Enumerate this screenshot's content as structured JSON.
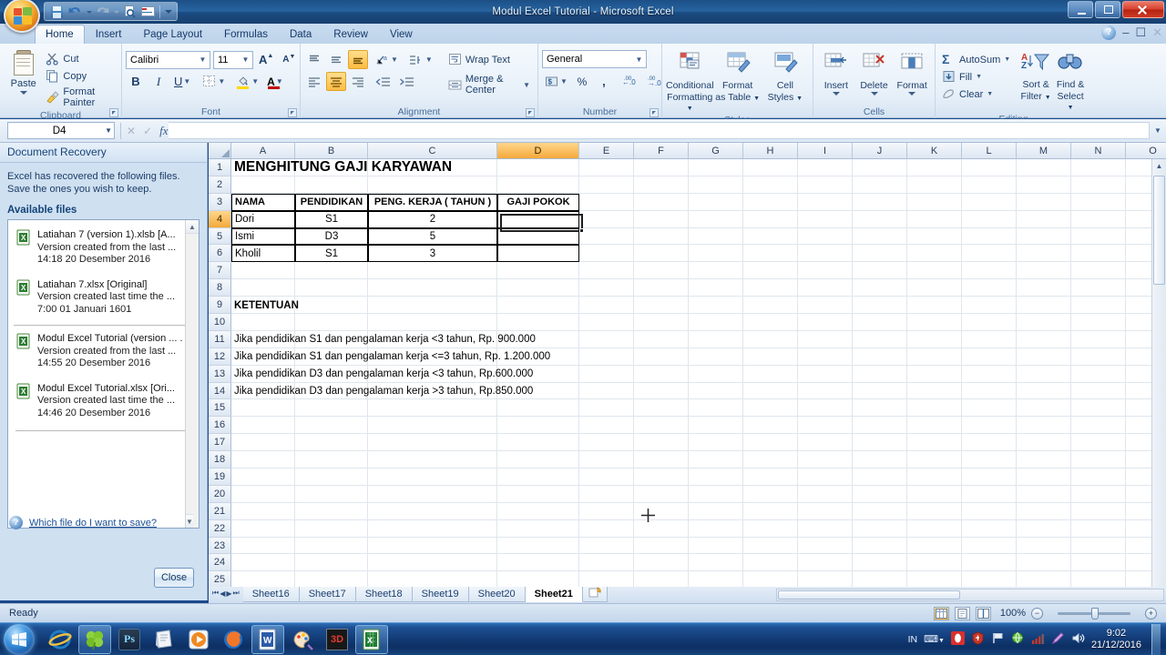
{
  "window": {
    "title": "Modul Excel Tutorial - Microsoft Excel",
    "minimize_label": "Minimize",
    "restore_label": "Restore",
    "close_label": "Close"
  },
  "quick_access": {
    "items": [
      {
        "name": "save-icon",
        "label": "Save"
      },
      {
        "name": "undo-icon",
        "label": "Undo"
      },
      {
        "name": "undo-dropdown-icon",
        "label": "Undo options"
      },
      {
        "name": "redo-icon",
        "label": "Redo"
      },
      {
        "name": "redo-dropdown-icon",
        "label": "Redo options"
      },
      {
        "name": "print-preview-icon",
        "label": "Print Preview"
      },
      {
        "name": "spelling-icon",
        "label": "Spelling"
      },
      {
        "name": "customize-qat-icon",
        "label": "Customize Quick Access Toolbar"
      }
    ]
  },
  "ribbon": {
    "tabs": [
      {
        "label": "Home",
        "active": true
      },
      {
        "label": "Insert",
        "active": false
      },
      {
        "label": "Page Layout",
        "active": false
      },
      {
        "label": "Formulas",
        "active": false
      },
      {
        "label": "Data",
        "active": false
      },
      {
        "label": "Review",
        "active": false
      },
      {
        "label": "View",
        "active": false
      }
    ],
    "help_label": "?",
    "clipboard": {
      "group_label": "Clipboard",
      "paste_label": "Paste",
      "cut_label": "Cut",
      "copy_label": "Copy",
      "format_painter_label": "Format Painter"
    },
    "font": {
      "group_label": "Font",
      "font_name": "Calibri",
      "font_size": "11",
      "grow_font_label": "A",
      "shrink_font_label": "A",
      "bold_label": "B",
      "italic_label": "I",
      "underline_label": "U",
      "borders_label": "Borders",
      "fill_color_label": "Fill Color",
      "font_color_label": "A"
    },
    "alignment": {
      "group_label": "Alignment",
      "wrap_text_label": "Wrap Text",
      "merge_center_label": "Merge & Center",
      "top_align_label": "Top Align",
      "middle_align_label": "Middle Align",
      "bottom_align_label": "Bottom Align",
      "orientation_label": "Orientation",
      "indent_label": "Indent",
      "align_left_label": "Align Text Left",
      "align_center_label": "Center",
      "align_right_label": "Align Text Right",
      "decrease_indent_label": "Decrease Indent",
      "increase_indent_label": "Increase Indent"
    },
    "number": {
      "group_label": "Number",
      "format_value": "General",
      "accounting_label": "Accounting Number Format",
      "percent_label": "%",
      "comma_label": "Comma Style",
      "increase_decimal_label": "Increase Decimal",
      "decrease_decimal_label": "Decrease Decimal"
    },
    "styles": {
      "group_label": "Styles",
      "conditional_formatting_label": "Conditional\nFormatting",
      "conditional_formatting_line1": "Conditional",
      "conditional_formatting_line2": "Formatting",
      "format_as_table_line1": "Format",
      "format_as_table_line2": "as Table",
      "cell_styles_line1": "Cell",
      "cell_styles_line2": "Styles"
    },
    "cells": {
      "group_label": "Cells",
      "insert_label": "Insert",
      "delete_label": "Delete",
      "format_label": "Format"
    },
    "editing": {
      "group_label": "Editing",
      "autosum_label": "AutoSum",
      "fill_label": "Fill",
      "clear_label": "Clear",
      "sort_filter_line1": "Sort &",
      "sort_filter_line2": "Filter",
      "find_select_line1": "Find &",
      "find_select_line2": "Select"
    }
  },
  "formula_bar": {
    "name_box_value": "D4",
    "formula_value": "",
    "cancel_label": "Cancel",
    "enter_label": "Enter",
    "insert_function_label": "fx"
  },
  "document_recovery": {
    "title": "Document Recovery",
    "intro": "Excel has recovered the following files.  Save the ones you wish to keep.",
    "available_files_label": "Available files",
    "files": [
      {
        "filename": "Latiahan 7 (version 1).xlsb  [A...",
        "description": "Version created from the last ...",
        "timestamp": "14:18 20 Desember 2016",
        "divider_above": false
      },
      {
        "filename": "Latiahan 7.xlsx  [Original]",
        "description": "Version created last time the ...",
        "timestamp": "7:00 01 Januari 1601",
        "divider_above": false
      },
      {
        "filename": "Modul Excel Tutorial (version ... .",
        "description": "Version created from the last ...",
        "timestamp": "14:55 20 Desember 2016",
        "divider_above": true
      },
      {
        "filename": "Modul Excel Tutorial.xlsx  [Ori...",
        "description": "Version created last time the ...",
        "timestamp": "14:46 20 Desember 2016",
        "divider_above": false
      }
    ],
    "help_link": "Which file do I want to save?",
    "close_button": "Close",
    "scroll_up_label": "▲",
    "scroll_down_label": "▼"
  },
  "sheet": {
    "columns": [
      "A",
      "B",
      "C",
      "D",
      "E",
      "F",
      "G",
      "H",
      "I",
      "J",
      "K",
      "L",
      "M",
      "N",
      "O"
    ],
    "selected_column": "D",
    "selected_row": 4,
    "rows": [
      1,
      2,
      3,
      4,
      5,
      6,
      7,
      8,
      9,
      10,
      11,
      12,
      13,
      14,
      15,
      16,
      17,
      18,
      19,
      20,
      21,
      22,
      23,
      24,
      25
    ],
    "title_cell": "MENGHITUNG GAJI KARYAWAN",
    "table_headers": [
      "NAMA",
      "PENDIDIKAN",
      "PENG. KERJA ( TAHUN )",
      "GAJI POKOK"
    ],
    "table_rows": [
      {
        "nama": "Dori",
        "pendidikan": "S1",
        "pengalaman": "2",
        "gaji": ""
      },
      {
        "nama": "Ismi",
        "pendidikan": "D3",
        "pengalaman": "5",
        "gaji": ""
      },
      {
        "nama": "Kholil",
        "pendidikan": "S1",
        "pengalaman": "3",
        "gaji": ""
      }
    ],
    "ketentuan_label": "KETENTUAN",
    "ketentuan": [
      "Jika pendidikan S1 dan pengalaman kerja <3 tahun, Rp. 900.000",
      "Jika pendidikan S1 dan pengalaman kerja <=3 tahun, Rp. 1.200.000",
      "Jika pendidikan D3 dan pengalaman kerja <3 tahun, Rp.600.000",
      "Jika pendidikan D3 dan pengalaman kerja >3 tahun, Rp.850.000"
    ]
  },
  "sheet_tabs": {
    "first_label": "First Sheet",
    "prev_label": "Previous Sheet",
    "next_label": "Next Sheet",
    "last_label": "Last Sheet",
    "tabs": [
      {
        "label": "Sheet16",
        "active": false
      },
      {
        "label": "Sheet17",
        "active": false
      },
      {
        "label": "Sheet18",
        "active": false
      },
      {
        "label": "Sheet19",
        "active": false
      },
      {
        "label": "Sheet20",
        "active": false
      },
      {
        "label": "Sheet21",
        "active": true
      }
    ],
    "insert_sheet_label": "Insert Worksheet"
  },
  "status_bar": {
    "status": "Ready",
    "normal_view_label": "Normal",
    "page_layout_label": "Page Layout",
    "page_break_label": "Page Break Preview",
    "zoom": "100%",
    "zoom_out_label": "−",
    "zoom_in_label": "+"
  },
  "taskbar": {
    "start_label": "Start",
    "apps": [
      {
        "name": "internet-explorer-icon",
        "label": "Internet Explorer",
        "pressed": false
      },
      {
        "name": "clover-icon",
        "label": "Clover",
        "pressed": true
      },
      {
        "name": "photoshop-icon",
        "label": "Adobe Photoshop",
        "pressed": false
      },
      {
        "name": "notepad-icon",
        "label": "Notepad",
        "pressed": false
      },
      {
        "name": "media-player-icon",
        "label": "Media Player",
        "pressed": false
      },
      {
        "name": "firefox-icon",
        "label": "Mozilla Firefox",
        "pressed": false
      },
      {
        "name": "word-icon",
        "label": "Microsoft Word",
        "pressed": true
      },
      {
        "name": "paint-icon",
        "label": "Paint",
        "pressed": false
      },
      {
        "name": "3d-app-icon",
        "label": "3D Application",
        "pressed": false
      },
      {
        "name": "excel-icon",
        "label": "Microsoft Excel",
        "pressed": true
      }
    ],
    "tray": {
      "input_indicator": "IN",
      "icons": [
        {
          "name": "keyboard-layout-icon",
          "label": "Language bar"
        },
        {
          "name": "opera-icon",
          "label": "Opera"
        },
        {
          "name": "antivirus-icon",
          "label": "Antivirus"
        },
        {
          "name": "network-flag-icon",
          "label": "Action Center"
        },
        {
          "name": "network-globe-icon",
          "label": "Network"
        },
        {
          "name": "signal-icon",
          "label": "Signal"
        },
        {
          "name": "pen-icon",
          "label": "Pen"
        },
        {
          "name": "volume-icon",
          "label": "Volume"
        }
      ],
      "time": "9:02",
      "date": "21/12/2016"
    },
    "show_desktop_label": "Show desktop"
  },
  "colors": {
    "accent_orange": "#f5a93c",
    "title_blue": "#1c4f86",
    "ribbon_bg": "#e6eff8",
    "pane_bg": "#cfe0f1",
    "close_red": "#d8402c"
  }
}
